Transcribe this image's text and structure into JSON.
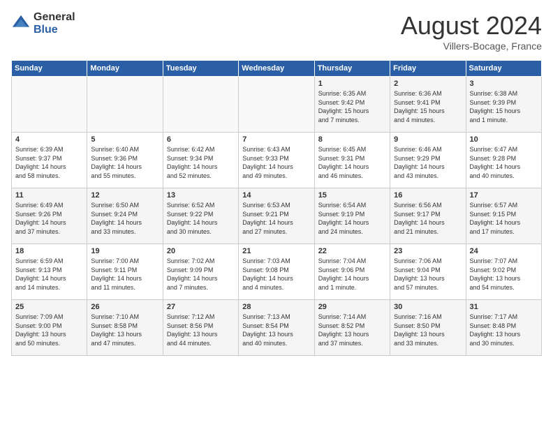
{
  "logo": {
    "general": "General",
    "blue": "Blue"
  },
  "title": {
    "month_year": "August 2024",
    "location": "Villers-Bocage, France"
  },
  "days_of_week": [
    "Sunday",
    "Monday",
    "Tuesday",
    "Wednesday",
    "Thursday",
    "Friday",
    "Saturday"
  ],
  "weeks": [
    [
      {
        "day": "",
        "info": ""
      },
      {
        "day": "",
        "info": ""
      },
      {
        "day": "",
        "info": ""
      },
      {
        "day": "",
        "info": ""
      },
      {
        "day": "1",
        "info": "Sunrise: 6:35 AM\nSunset: 9:42 PM\nDaylight: 15 hours\nand 7 minutes."
      },
      {
        "day": "2",
        "info": "Sunrise: 6:36 AM\nSunset: 9:41 PM\nDaylight: 15 hours\nand 4 minutes."
      },
      {
        "day": "3",
        "info": "Sunrise: 6:38 AM\nSunset: 9:39 PM\nDaylight: 15 hours\nand 1 minute."
      }
    ],
    [
      {
        "day": "4",
        "info": "Sunrise: 6:39 AM\nSunset: 9:37 PM\nDaylight: 14 hours\nand 58 minutes."
      },
      {
        "day": "5",
        "info": "Sunrise: 6:40 AM\nSunset: 9:36 PM\nDaylight: 14 hours\nand 55 minutes."
      },
      {
        "day": "6",
        "info": "Sunrise: 6:42 AM\nSunset: 9:34 PM\nDaylight: 14 hours\nand 52 minutes."
      },
      {
        "day": "7",
        "info": "Sunrise: 6:43 AM\nSunset: 9:33 PM\nDaylight: 14 hours\nand 49 minutes."
      },
      {
        "day": "8",
        "info": "Sunrise: 6:45 AM\nSunset: 9:31 PM\nDaylight: 14 hours\nand 46 minutes."
      },
      {
        "day": "9",
        "info": "Sunrise: 6:46 AM\nSunset: 9:29 PM\nDaylight: 14 hours\nand 43 minutes."
      },
      {
        "day": "10",
        "info": "Sunrise: 6:47 AM\nSunset: 9:28 PM\nDaylight: 14 hours\nand 40 minutes."
      }
    ],
    [
      {
        "day": "11",
        "info": "Sunrise: 6:49 AM\nSunset: 9:26 PM\nDaylight: 14 hours\nand 37 minutes."
      },
      {
        "day": "12",
        "info": "Sunrise: 6:50 AM\nSunset: 9:24 PM\nDaylight: 14 hours\nand 33 minutes."
      },
      {
        "day": "13",
        "info": "Sunrise: 6:52 AM\nSunset: 9:22 PM\nDaylight: 14 hours\nand 30 minutes."
      },
      {
        "day": "14",
        "info": "Sunrise: 6:53 AM\nSunset: 9:21 PM\nDaylight: 14 hours\nand 27 minutes."
      },
      {
        "day": "15",
        "info": "Sunrise: 6:54 AM\nSunset: 9:19 PM\nDaylight: 14 hours\nand 24 minutes."
      },
      {
        "day": "16",
        "info": "Sunrise: 6:56 AM\nSunset: 9:17 PM\nDaylight: 14 hours\nand 21 minutes."
      },
      {
        "day": "17",
        "info": "Sunrise: 6:57 AM\nSunset: 9:15 PM\nDaylight: 14 hours\nand 17 minutes."
      }
    ],
    [
      {
        "day": "18",
        "info": "Sunrise: 6:59 AM\nSunset: 9:13 PM\nDaylight: 14 hours\nand 14 minutes."
      },
      {
        "day": "19",
        "info": "Sunrise: 7:00 AM\nSunset: 9:11 PM\nDaylight: 14 hours\nand 11 minutes."
      },
      {
        "day": "20",
        "info": "Sunrise: 7:02 AM\nSunset: 9:09 PM\nDaylight: 14 hours\nand 7 minutes."
      },
      {
        "day": "21",
        "info": "Sunrise: 7:03 AM\nSunset: 9:08 PM\nDaylight: 14 hours\nand 4 minutes."
      },
      {
        "day": "22",
        "info": "Sunrise: 7:04 AM\nSunset: 9:06 PM\nDaylight: 14 hours\nand 1 minute."
      },
      {
        "day": "23",
        "info": "Sunrise: 7:06 AM\nSunset: 9:04 PM\nDaylight: 13 hours\nand 57 minutes."
      },
      {
        "day": "24",
        "info": "Sunrise: 7:07 AM\nSunset: 9:02 PM\nDaylight: 13 hours\nand 54 minutes."
      }
    ],
    [
      {
        "day": "25",
        "info": "Sunrise: 7:09 AM\nSunset: 9:00 PM\nDaylight: 13 hours\nand 50 minutes."
      },
      {
        "day": "26",
        "info": "Sunrise: 7:10 AM\nSunset: 8:58 PM\nDaylight: 13 hours\nand 47 minutes."
      },
      {
        "day": "27",
        "info": "Sunrise: 7:12 AM\nSunset: 8:56 PM\nDaylight: 13 hours\nand 44 minutes."
      },
      {
        "day": "28",
        "info": "Sunrise: 7:13 AM\nSunset: 8:54 PM\nDaylight: 13 hours\nand 40 minutes."
      },
      {
        "day": "29",
        "info": "Sunrise: 7:14 AM\nSunset: 8:52 PM\nDaylight: 13 hours\nand 37 minutes."
      },
      {
        "day": "30",
        "info": "Sunrise: 7:16 AM\nSunset: 8:50 PM\nDaylight: 13 hours\nand 33 minutes."
      },
      {
        "day": "31",
        "info": "Sunrise: 7:17 AM\nSunset: 8:48 PM\nDaylight: 13 hours\nand 30 minutes."
      }
    ]
  ]
}
